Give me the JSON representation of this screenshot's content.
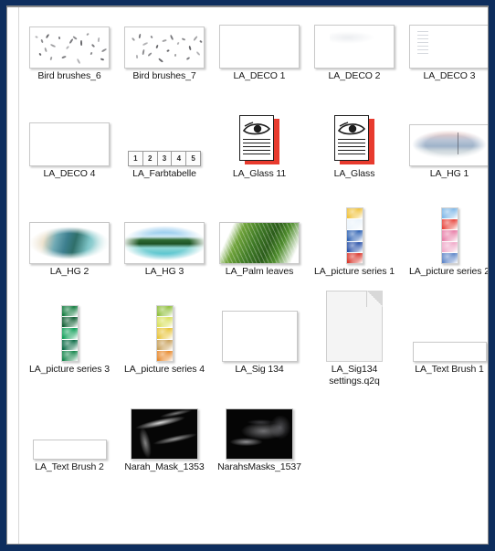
{
  "window": {
    "accent_color": "#0e2e5e",
    "background_color": "#ffffff",
    "border_color": "#8a8a8a"
  },
  "file_grid": {
    "columns": 5,
    "view": "large-icons",
    "items": [
      {
        "label": "Bird brushes_6",
        "thumb": "birds",
        "name": "bird-brushes-6"
      },
      {
        "label": "Bird brushes_7",
        "thumb": "birds",
        "name": "bird-brushes-7"
      },
      {
        "label": "LA_DECO 1",
        "thumb": "blank",
        "name": "la-deco-1"
      },
      {
        "label": "LA_DECO 2",
        "thumb": "deco2",
        "name": "la-deco-2"
      },
      {
        "label": "LA_DECO 3",
        "thumb": "deco3",
        "name": "la-deco-3"
      },
      {
        "label": "LA_DECO 4",
        "thumb": "blank",
        "name": "la-deco-4"
      },
      {
        "label": "LA_Farbtabelle",
        "thumb": "farbtabelle",
        "name": "la-farbtabelle",
        "cells": [
          "1",
          "2",
          "3",
          "4",
          "5"
        ]
      },
      {
        "label": "LA_Glass 11",
        "thumb": "glass",
        "name": "la-glass-11"
      },
      {
        "label": "LA_Glass",
        "thumb": "glass",
        "name": "la-glass"
      },
      {
        "label": "LA_HG 1",
        "thumb": "hg1",
        "name": "la-hg-1"
      },
      {
        "label": "LA_HG 2",
        "thumb": "hg2",
        "name": "la-hg-2"
      },
      {
        "label": "LA_HG 3",
        "thumb": "hg3",
        "name": "la-hg-3"
      },
      {
        "label": "LA_Palm leaves",
        "thumb": "palm",
        "name": "la-palm-leaves"
      },
      {
        "label": "LA_picture series 1",
        "thumb": "series",
        "name": "la-picture-series-1",
        "colors": [
          "#f0c23a",
          "#eaf3fb",
          "#2f63b4",
          "#2750a8",
          "#d9362b"
        ]
      },
      {
        "label": "LA_picture series 2",
        "thumb": "series",
        "name": "la-picture-series-2",
        "colors": [
          "#7fb8e8",
          "#e8453c",
          "#e87fa8",
          "#f0a8c8",
          "#5f86c8"
        ]
      },
      {
        "label": "LA_picture series 3",
        "thumb": "series",
        "name": "la-picture-series-3",
        "colors": [
          "#0f7a3c",
          "#0c5c30",
          "#11a05a",
          "#0a6b45",
          "#13854a"
        ]
      },
      {
        "label": "LA_picture series 4",
        "thumb": "series",
        "name": "la-picture-series-4",
        "colors": [
          "#8fbf3a",
          "#d8e05a",
          "#e8c43a",
          "#c8a05a",
          "#e8882a"
        ]
      },
      {
        "label": "LA_Sig 134",
        "thumb": "tallblank",
        "name": "la-sig-134"
      },
      {
        "label": "LA_Sig134 settings.q2q",
        "thumb": "file",
        "name": "la-sig134-settings-q2q"
      },
      {
        "label": "LA_Text Brush 1",
        "thumb": "strip",
        "name": "la-text-brush-1"
      },
      {
        "label": "LA_Text Brush 2",
        "thumb": "strip",
        "name": "la-text-brush-2"
      },
      {
        "label": "Narah_Mask_1353",
        "thumb": "mask1",
        "name": "narah-mask-1353"
      },
      {
        "label": "NarahsMasks_1537",
        "thumb": "mask2",
        "name": "narahsmasks-1537"
      }
    ]
  }
}
